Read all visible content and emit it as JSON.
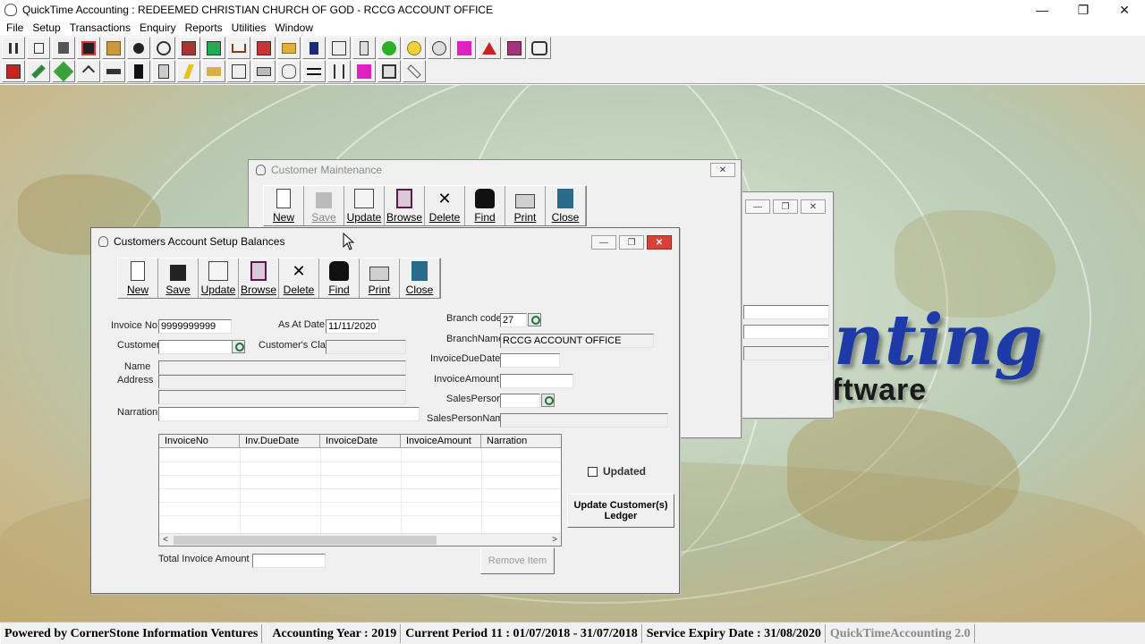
{
  "app": {
    "title": "QuickTime Accounting : REDEEMED CHRISTIAN CHURCH OF GOD  - RCCG ACCOUNT OFFICE",
    "minimize": "—",
    "restore": "❐",
    "close": "✕"
  },
  "menu": [
    "File",
    "Setup",
    "Transactions",
    "Enquiry",
    "Reports",
    "Utilities",
    "Window"
  ],
  "background": {
    "logo_text": "nting",
    "logo_sub": "ftware"
  },
  "customer_maintenance": {
    "title": "Customer  Maintenance",
    "close": "✕",
    "toolbar": {
      "new": "New",
      "save": "Save",
      "update": "Update",
      "browse": "Browse",
      "delete": "Delete",
      "find": "Find",
      "print": "Print",
      "close": "Close"
    }
  },
  "hidden_window": {
    "minimize": "—",
    "restore": "❐",
    "close": "✕"
  },
  "setup_balances": {
    "title": "Customers Account Setup Balances",
    "minimize": "—",
    "restore": "❐",
    "close": "✕",
    "toolbar": {
      "new": "New",
      "save": "Save",
      "update": "Update",
      "browse": "Browse",
      "delete": "Delete",
      "find": "Find",
      "print": "Print",
      "close": "Close"
    },
    "fields": {
      "invoice_no_label": "Invoice No",
      "invoice_no_value": "9999999999",
      "as_at_date_label": "As At Date",
      "as_at_date_value": "11/11/2020",
      "customer_label": "Customer",
      "customer_value": "",
      "customers_class_label": "Customer's Class",
      "customers_class_value": "",
      "name_label": "Name",
      "address_label": "Address",
      "narration_label": "Narration",
      "branch_code_label": "Branch code",
      "branch_code_value": "27",
      "branch_name_label": "BranchName",
      "branch_name_value": "RCCG ACCOUNT OFFICE",
      "invoice_due_date_label": "InvoiceDueDate",
      "invoice_amount_label": "InvoiceAmount",
      "sales_person_label": "SalesPerson",
      "sales_person_name_label": "SalesPersonName",
      "total_invoice_amount_label": "Total Invoice Amount"
    },
    "grid": {
      "columns": [
        "InvoiceNo",
        "Inv.DueDate",
        "InvoiceDate",
        "InvoiceAmount",
        "Narration"
      ],
      "rows": [],
      "scroll_left": "<",
      "scroll_right": ">"
    },
    "updated_label": "Updated",
    "update_ledger_button": "Update Customer(s) Ledger",
    "remove_item_button": "Remove Item"
  },
  "status_bar": [
    "Powered by CornerStone Information Ventures",
    "Accounting Year : 2019",
    "Current Period 11 : 01/07/2018 - 31/07/2018",
    "Service Expiry Date : 31/08/2020",
    "QuickTimeAccounting 2.0"
  ],
  "colors": {
    "logo_blue": "#1e3aa8",
    "close_red": "#d8413a"
  }
}
